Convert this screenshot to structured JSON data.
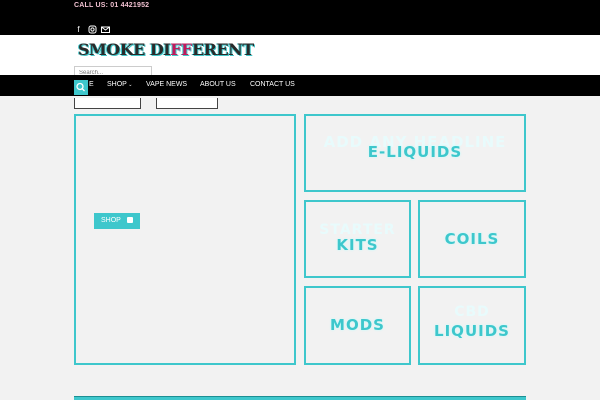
{
  "topbar": {
    "call_text": "CALL US: 01 4421952"
  },
  "header": {
    "logo_text": "SMOKE DI",
    "logo_mark": "FF",
    "logo_tail": "ERENT",
    "search_placeholder": "Search..."
  },
  "nav": {
    "fragment": "E",
    "items": [
      "SHOP",
      "VAPE NEWS",
      "ABOUT US",
      "CONTACT US"
    ]
  },
  "hero": {
    "shop_label": "SHOP"
  },
  "tiles": {
    "eliquids": {
      "ghost": "ADD ANY HEADLINE",
      "label": "E-LIQUIDS"
    },
    "starter": {
      "ghost": "STARTER",
      "label": "KITS"
    },
    "coils": {
      "label": "COILS"
    },
    "mods": {
      "label": "MODS"
    },
    "cbd": {
      "ghost": "CBD",
      "label": "LIQUIDS"
    }
  },
  "colors": {
    "accent": "#3ec7cc",
    "dark": "#000000",
    "background": "#f2f2f2"
  }
}
